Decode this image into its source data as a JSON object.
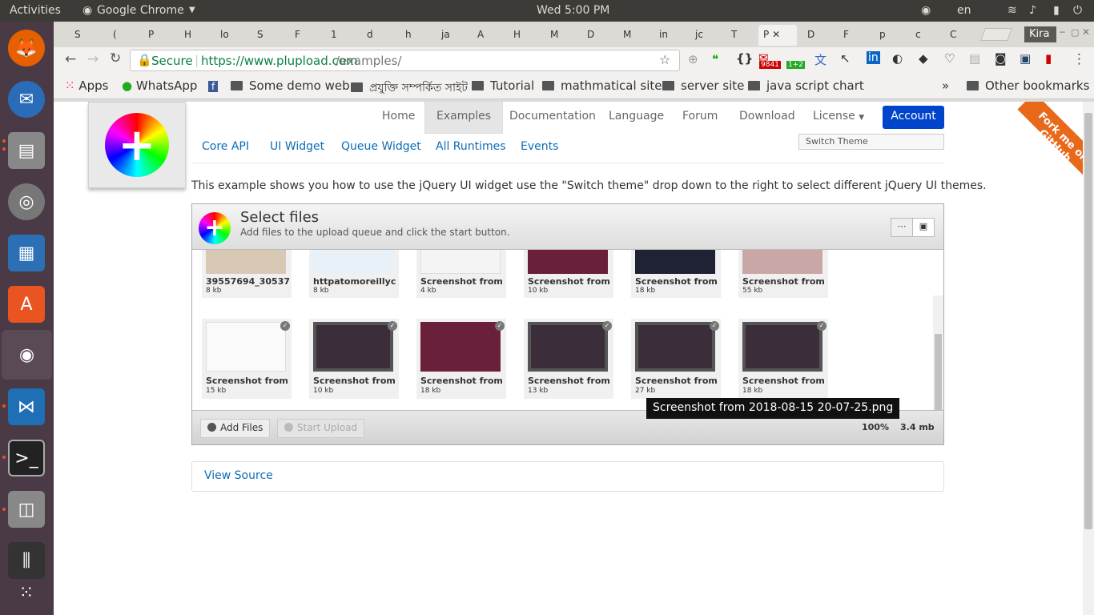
{
  "os": {
    "activities": "Activities",
    "app_name": "Google Chrome",
    "clock": "Wed  5:00 PM",
    "lang": "en",
    "user": "Kira"
  },
  "browser": {
    "tabs": [
      "S",
      "(",
      "P",
      "H",
      "lo",
      "S",
      "F",
      "1",
      "d",
      "h",
      "ja",
      "A",
      "H",
      "M",
      "D",
      "M",
      "in",
      "jc",
      "T",
      "P",
      "D",
      "F",
      "p",
      "c",
      "C"
    ],
    "secure_label": "Secure",
    "url_base": "https://www.plupload.com",
    "url_path": "/examples/",
    "badge_mail": "9841",
    "badge_plus": "1+2",
    "bookmarks": [
      "Apps",
      "WhatsApp",
      "Some demo web",
      "প্রযুক্তি সম্পর্কিত সাইট",
      "Tutorial",
      "mathmatical site",
      "server site",
      "java script chart"
    ],
    "other_bookmarks": "Other bookmarks"
  },
  "site": {
    "nav": [
      "Home",
      "Examples",
      "Documentation",
      "Language",
      "Forum",
      "Download",
      "License"
    ],
    "account": "Account",
    "subnav": [
      "Core API",
      "UI Widget",
      "Queue Widget",
      "All Runtimes",
      "Events"
    ],
    "switch_theme": "Switch Theme",
    "ribbon": "Fork me on GitHub",
    "description": "This example shows you how to use the jQuery UI widget use the \"Switch theme\" drop down to the right to select different jQuery UI themes.",
    "uploader": {
      "title": "Select files",
      "subtitle": "Add files to the upload queue and click the start button.",
      "files_row1": [
        {
          "name": "39557694_30537...",
          "size": "8 kb"
        },
        {
          "name": "httpatomoreillyc...",
          "size": "8 kb"
        },
        {
          "name": "Screenshot from...",
          "size": "4 kb"
        },
        {
          "name": "Screenshot from...",
          "size": "10 kb"
        },
        {
          "name": "Screenshot from...",
          "size": "18 kb"
        },
        {
          "name": "Screenshot from...",
          "size": "55 kb"
        }
      ],
      "files_row2": [
        {
          "name": "Screenshot from...",
          "size": "15 kb"
        },
        {
          "name": "Screenshot from...",
          "size": "10 kb"
        },
        {
          "name": "Screenshot from...",
          "size": "18 kb"
        },
        {
          "name": "Screenshot from...",
          "size": "13 kb"
        },
        {
          "name": "Screenshot from...",
          "size": "27 kb"
        },
        {
          "name": "Screenshot from...",
          "size": "18 kb"
        }
      ],
      "add_files": "Add Files",
      "start_upload": "Start Upload",
      "percent": "100%",
      "total_size": "3.4 mb",
      "tooltip": "Screenshot from 2018-08-15 20-07-25.png"
    },
    "view_source": "View Source"
  }
}
